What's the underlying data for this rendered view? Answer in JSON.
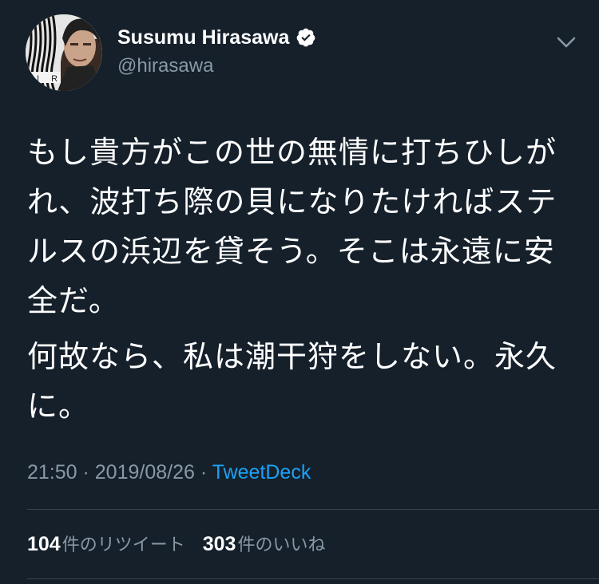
{
  "author": {
    "name": "Susumu Hirasawa",
    "handle": "@hirasawa",
    "verified": true,
    "avatar_icon": "profile-photo"
  },
  "tweet": {
    "paragraphs": [
      "もし貴方がこの世の無情に打ちひしがれ、波打ち際の貝になりたければステルスの浜辺を貸そう。そこは永遠に安全だ。",
      "何故なら、私は潮干狩をしない。永久に。"
    ]
  },
  "meta": {
    "time": "21:50",
    "separator": " · ",
    "date": "2019/08/26",
    "source": "TweetDeck"
  },
  "stats": {
    "retweets_count": "104",
    "retweets_label": "件のリツイート",
    "likes_count": "303",
    "likes_label": "件のいいね"
  },
  "colors": {
    "background": "#15202b",
    "text": "#ffffff",
    "secondary": "#8899a6",
    "link": "#1da1f2",
    "divider": "#38444d"
  }
}
